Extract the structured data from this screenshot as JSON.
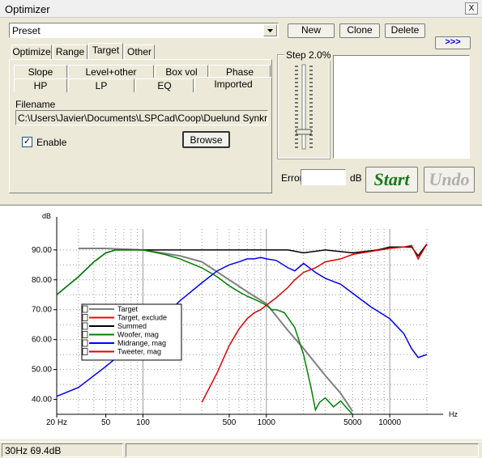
{
  "window": {
    "title": "Optimizer",
    "close_label": "X"
  },
  "preset": {
    "value": "Preset"
  },
  "buttons": {
    "new": "New",
    "clone": "Clone",
    "delete": "Delete",
    "more": ">>>",
    "browse": "Browse",
    "start": "Start",
    "undo": "Undo"
  },
  "tabs_main": [
    "Optimize",
    "Range",
    "Target",
    "Other"
  ],
  "tabs_sub_row1": [
    "Slope",
    "Level+other",
    "Box vol",
    "Phase"
  ],
  "tabs_sub_row2": [
    "HP",
    "LP",
    "EQ",
    "Imported"
  ],
  "filename": {
    "label": "Filename",
    "value": "C:\\Users\\Javier\\Documents\\LSPCad\\Coop\\Duelund Synkron\\A"
  },
  "enable": {
    "label": "Enable",
    "checked": true,
    "mark": "✓"
  },
  "step": {
    "label": "Step 2.0%"
  },
  "error": {
    "label": "Error",
    "value": "",
    "unit": "dB"
  },
  "status": {
    "text": "30Hz 69.4dB"
  },
  "colors": {
    "target": "#808080",
    "target_exclude": "#ff0000",
    "summed": "#000000",
    "woofer": "#008000",
    "midrange": "#0000ff",
    "tweeter": "#e00000",
    "start": "#1a7a1a",
    "undo": "#b0b0b0"
  },
  "chart_data": {
    "type": "line",
    "xscale": "log",
    "xlim": [
      20,
      20000
    ],
    "ylim": [
      35,
      97
    ],
    "ylabel": "dB",
    "xlabel": "Hz",
    "xticks": [
      20,
      50,
      100,
      500,
      1000,
      5000,
      10000
    ],
    "xtick_labels": [
      "20 Hz",
      "50",
      "100",
      "500",
      "1000",
      "5000",
      "10000"
    ],
    "yticks": [
      40,
      50,
      60,
      70,
      80,
      90
    ],
    "ytick_labels": [
      "40.00",
      "50.00",
      "60.00",
      "70.00",
      "80.00",
      "90.00"
    ],
    "grid": true,
    "legend": "left-middle",
    "series": [
      {
        "name": "Target",
        "color": "#808080",
        "x": [
          30,
          50,
          100,
          200,
          300,
          500,
          700,
          1000,
          1500,
          2000,
          3000,
          4000,
          5000
        ],
        "y": [
          90.5,
          90.5,
          90,
          88,
          86,
          80,
          76,
          72,
          63,
          57,
          48,
          42,
          36
        ]
      },
      {
        "name": "Target, exclude",
        "color": "#ff0000",
        "x": [],
        "y": []
      },
      {
        "name": "Summed",
        "color": "#000000",
        "x": [
          20,
          30,
          40,
          50,
          60,
          80,
          100,
          200,
          500,
          1000,
          1500,
          2000,
          3000,
          5000,
          8000,
          10000,
          13000,
          15000,
          17000,
          20000
        ],
        "y": [
          75,
          81,
          86,
          89,
          90,
          90,
          90,
          90,
          90,
          90,
          90,
          89,
          90,
          89,
          90,
          91,
          91,
          91,
          88,
          92
        ]
      },
      {
        "name": "Woofer, mag",
        "color": "#008000",
        "x": [
          20,
          30,
          40,
          50,
          60,
          80,
          100,
          150,
          200,
          300,
          400,
          500,
          600,
          700,
          800,
          900,
          1000,
          1100,
          1200,
          1400,
          1700,
          2000,
          2300,
          2500,
          2700,
          3000,
          3500,
          4000,
          4500,
          5000
        ],
        "y": [
          75,
          81,
          86,
          89,
          90,
          90,
          90,
          88.5,
          87,
          84,
          81,
          78,
          76,
          74.5,
          73.5,
          72.5,
          71.5,
          70,
          70,
          69,
          64,
          55,
          44,
          36.5,
          39,
          40.5,
          37.5,
          39.5,
          37,
          35
        ]
      },
      {
        "name": "Midrange, mag",
        "color": "#0000ff",
        "x": [
          20,
          30,
          50,
          80,
          100,
          150,
          200,
          300,
          400,
          500,
          600,
          700,
          800,
          900,
          1000,
          1200,
          1500,
          1700,
          2000,
          2500,
          3000,
          4000,
          5000,
          7000,
          10000,
          13000,
          15000,
          17000,
          20000
        ],
        "y": [
          41,
          44,
          51,
          58,
          61.5,
          68,
          73,
          79,
          83,
          85,
          86,
          87,
          87,
          87.5,
          87,
          86.5,
          84,
          83,
          85.5,
          82.5,
          80.5,
          78.5,
          75.5,
          71,
          67,
          62,
          57,
          54,
          55
        ]
      },
      {
        "name": "Tweeter, mag",
        "color": "#e00000",
        "x": [
          300,
          400,
          500,
          600,
          700,
          800,
          900,
          1000,
          1200,
          1500,
          1700,
          2000,
          2500,
          3000,
          4000,
          5000,
          7000,
          10000,
          13000,
          15000,
          17000,
          20000
        ],
        "y": [
          39,
          49,
          58,
          63.5,
          67,
          69,
          70,
          71.5,
          74,
          77.5,
          80,
          82.5,
          84,
          86,
          87,
          88.5,
          89.5,
          90.5,
          91,
          91.5,
          87,
          92
        ]
      }
    ]
  }
}
